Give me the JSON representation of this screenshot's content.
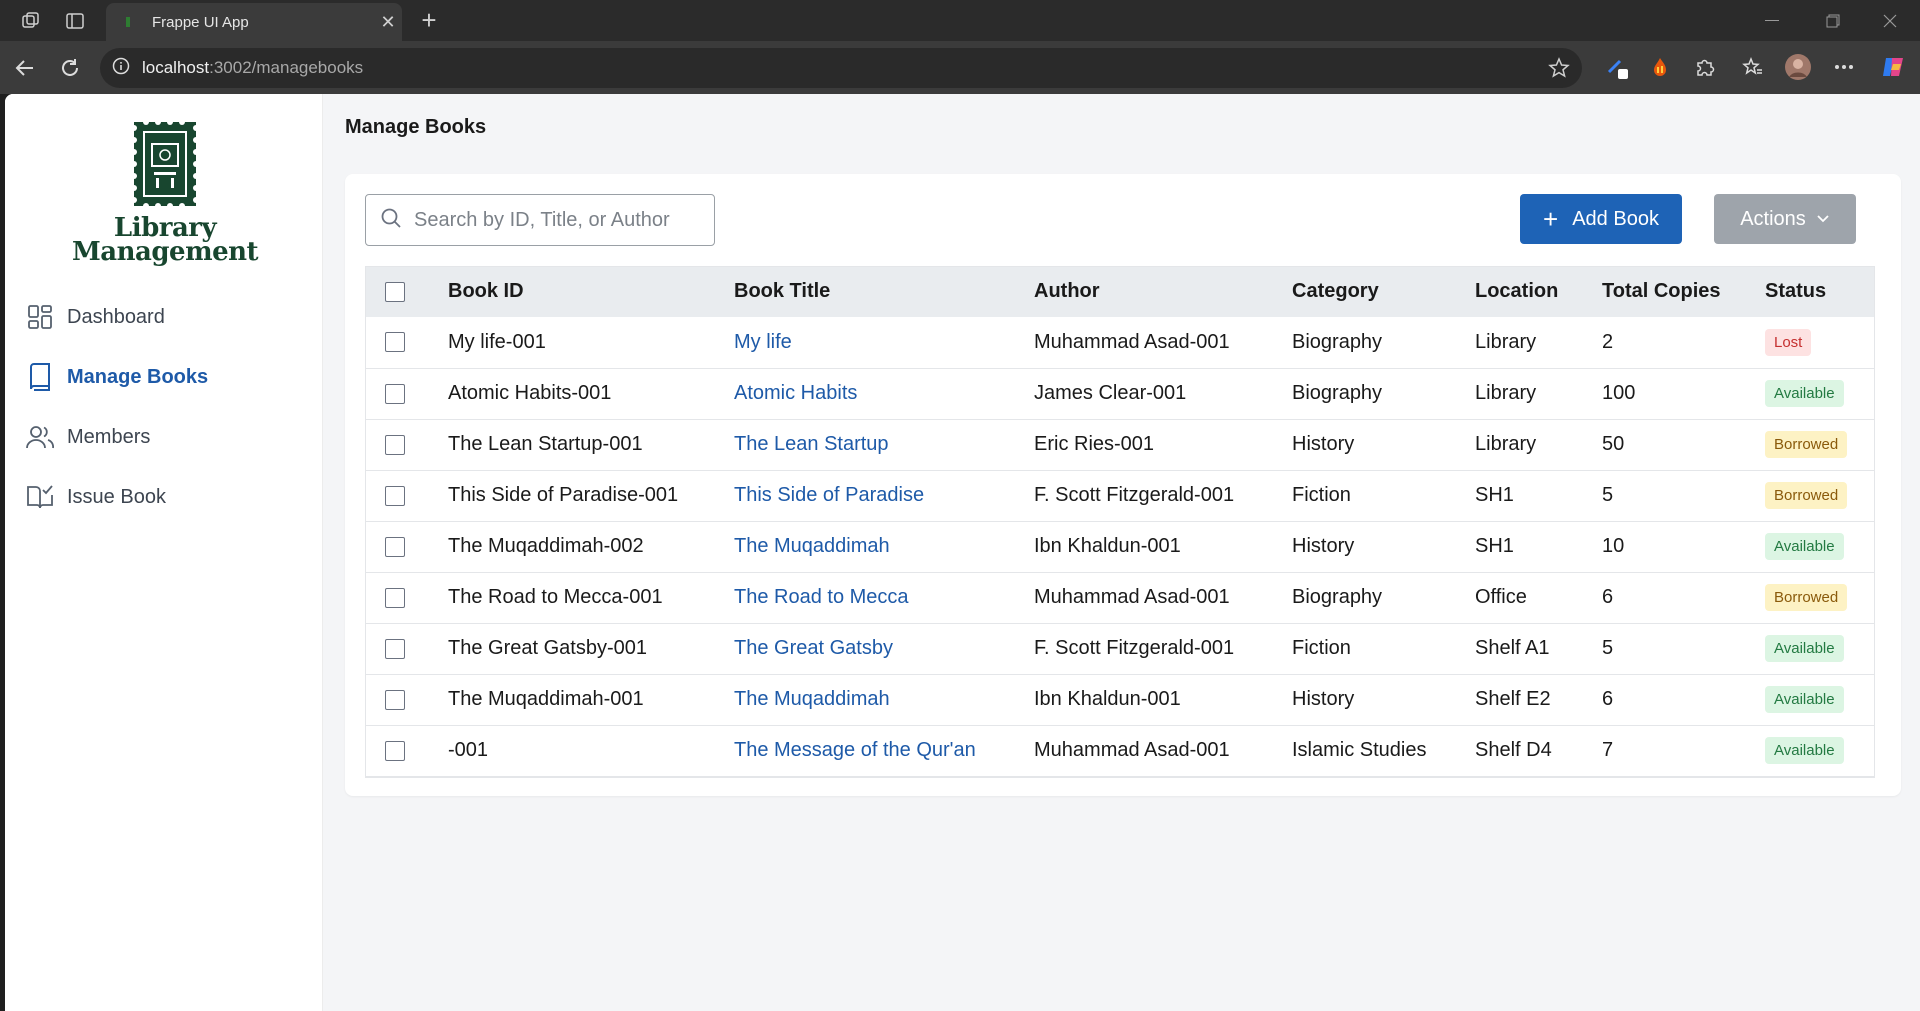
{
  "browser": {
    "tab_title": "Frappe UI App",
    "url_host": "localhost",
    "url_path": ":3002/managebooks"
  },
  "sidebar": {
    "logo_line1": "Library",
    "logo_line2": "Management",
    "items": [
      {
        "label": "Dashboard",
        "icon": "dashboard-icon"
      },
      {
        "label": "Manage Books",
        "icon": "book-icon"
      },
      {
        "label": "Members",
        "icon": "users-icon"
      },
      {
        "label": "Issue Book",
        "icon": "book-open-check-icon"
      }
    ]
  },
  "main": {
    "title": "Manage Books",
    "search_placeholder": "Search by ID, Title, or Author",
    "add_button": "Add Book",
    "actions_button": "Actions"
  },
  "table": {
    "headers": [
      "Book ID",
      "Book Title",
      "Author",
      "Category",
      "Location",
      "Total Copies",
      "Status"
    ],
    "rows": [
      {
        "id": "My life-001",
        "title": "My life",
        "author": "Muhammad Asad-001",
        "category": "Biography",
        "location": "Library",
        "copies": "2",
        "status": "Lost"
      },
      {
        "id": "Atomic Habits-001",
        "title": "Atomic Habits",
        "author": "James Clear-001",
        "category": "Biography",
        "location": "Library",
        "copies": "100",
        "status": "Available"
      },
      {
        "id": "The Lean Startup-001",
        "title": "The Lean Startup",
        "author": "Eric Ries-001",
        "category": "History",
        "location": "Library",
        "copies": "50",
        "status": "Borrowed"
      },
      {
        "id": "This Side of Paradise-001",
        "title": "This Side of Paradise",
        "author": "F. Scott Fitzgerald-001",
        "category": "Fiction",
        "location": "SH1",
        "copies": "5",
        "status": "Borrowed"
      },
      {
        "id": "The Muqaddimah-002",
        "title": "The Muqaddimah",
        "author": "Ibn Khaldun-001",
        "category": "History",
        "location": "SH1",
        "copies": "10",
        "status": "Available"
      },
      {
        "id": "The Road to Mecca-001",
        "title": "The Road to Mecca",
        "author": "Muhammad Asad-001",
        "category": "Biography",
        "location": "Office",
        "copies": "6",
        "status": "Borrowed"
      },
      {
        "id": "The Great Gatsby-001",
        "title": "The Great Gatsby",
        "author": "F. Scott Fitzgerald-001",
        "category": "Fiction",
        "location": "Shelf A1",
        "copies": "5",
        "status": "Available"
      },
      {
        "id": "The Muqaddimah-001",
        "title": "The Muqaddimah",
        "author": "Ibn Khaldun-001",
        "category": "History",
        "location": "Shelf E2",
        "copies": "6",
        "status": "Available"
      },
      {
        "id": "-001",
        "title": "The Message of the Qur'an",
        "author": "Muhammad Asad-001",
        "category": "Islamic Studies",
        "location": "Shelf D4",
        "copies": "7",
        "status": "Available"
      }
    ]
  },
  "colors": {
    "accent": "#1e63b6",
    "logo_green": "#18462f",
    "status_lost": "#c53030",
    "status_available": "#237a42",
    "status_borrowed": "#8a5a0b"
  }
}
